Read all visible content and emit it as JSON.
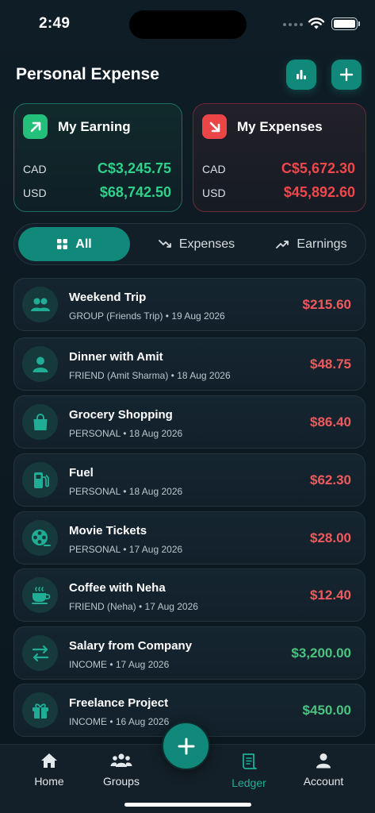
{
  "status_bar": {
    "time": "2:49"
  },
  "header": {
    "title": "Personal Expense",
    "stats_icon": "bar-chart-icon",
    "add_icon": "plus-icon"
  },
  "summary": {
    "earning": {
      "title": "My Earning",
      "icon": "arrow-up-right-icon",
      "rows": [
        {
          "currency": "CAD",
          "amount": "C$3,245.75"
        },
        {
          "currency": "USD",
          "amount": "$68,742.50"
        }
      ],
      "color": "#2ed08a"
    },
    "expenses": {
      "title": "My Expenses",
      "icon": "arrow-down-right-icon",
      "rows": [
        {
          "currency": "CAD",
          "amount": "C$5,672.30"
        },
        {
          "currency": "USD",
          "amount": "$45,892.60"
        }
      ],
      "color": "#f0474b"
    }
  },
  "filters": {
    "selected": "All",
    "tabs": [
      {
        "label": "All",
        "icon": "grid-icon"
      },
      {
        "label": "Expenses",
        "icon": "trend-down-icon"
      },
      {
        "label": "Earnings",
        "icon": "trend-up-icon"
      }
    ]
  },
  "transactions": [
    {
      "title": "Weekend Trip",
      "subtitle": "GROUP (Friends Trip) • 19 Aug 2026",
      "amount": "$215.60",
      "type": "expense",
      "icon": "group-icon"
    },
    {
      "title": "Dinner with Amit",
      "subtitle": "FRIEND (Amit Sharma) • 18 Aug 2026",
      "amount": "$48.75",
      "type": "expense",
      "icon": "person-icon"
    },
    {
      "title": "Grocery Shopping",
      "subtitle": "PERSONAL • 18 Aug 2026",
      "amount": "$86.40",
      "type": "expense",
      "icon": "shopping-bag-icon"
    },
    {
      "title": "Fuel",
      "subtitle": "PERSONAL • 18 Aug 2026",
      "amount": "$62.30",
      "type": "expense",
      "icon": "fuel-pump-icon"
    },
    {
      "title": "Movie Tickets",
      "subtitle": "PERSONAL • 17 Aug 2026",
      "amount": "$28.00",
      "type": "expense",
      "icon": "film-reel-icon"
    },
    {
      "title": "Coffee with Neha",
      "subtitle": "FRIEND (Neha) • 17 Aug 2026",
      "amount": "$12.40",
      "type": "expense",
      "icon": "coffee-cup-icon"
    },
    {
      "title": "Salary from Company",
      "subtitle": "INCOME • 17 Aug 2026",
      "amount": "$3,200.00",
      "type": "income",
      "icon": "transfer-arrows-icon"
    },
    {
      "title": "Freelance Project",
      "subtitle": "INCOME • 16 Aug 2026",
      "amount": "$450.00",
      "type": "income",
      "icon": "gift-icon"
    }
  ],
  "bottom_nav": {
    "items": [
      {
        "label": "Home",
        "icon": "home-icon"
      },
      {
        "label": "Groups",
        "icon": "groups-icon"
      },
      {
        "label": "Ledger",
        "icon": "ledger-icon",
        "active": true
      },
      {
        "label": "Account",
        "icon": "account-icon"
      }
    ],
    "fab_icon": "plus-icon"
  },
  "colors": {
    "accent": "#11897a",
    "expense": "#ef5a5c",
    "income": "#4cc281"
  }
}
